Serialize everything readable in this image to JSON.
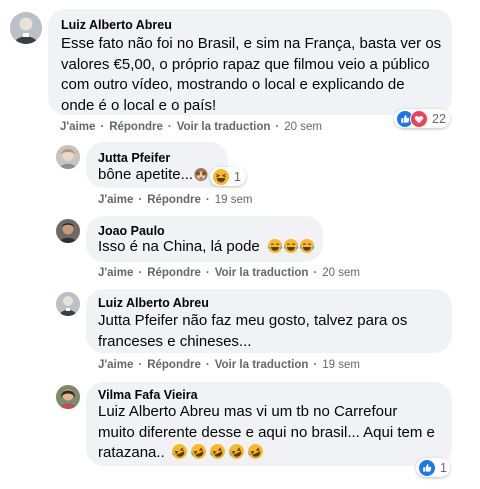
{
  "comments": [
    {
      "author": "Luiz Alberto Abreu",
      "text_lines": [
        "Esse fato não foi no Brasil, e sim na França, basta ver os",
        "valores €5,00, o próprio rapaz que filmou veio a público",
        "com outro vídeo, mostrando o local e explicando de",
        "onde é o local e o país!"
      ],
      "actions": {
        "like": "J'aime",
        "reply": "Répondre",
        "translate": "Voir la traduction",
        "time": "20 sem"
      },
      "reactions": {
        "icons": [
          "like-icon",
          "love-icon"
        ],
        "count": "22"
      }
    },
    {
      "author": "Jutta Pfeifer",
      "text": "bône apetite...",
      "text_emoji": "see-no-evil-monkey-icon",
      "actions": {
        "like": "J'aime",
        "reply": "Répondre",
        "time": "19 sem"
      },
      "reactions": {
        "icons": [
          "haha-icon"
        ],
        "count": "1"
      }
    },
    {
      "author": "Joao Paulo",
      "text": "Isso é na China, lá pode",
      "text_emoji": "tears-of-joy-icon",
      "text_emoji_count": 3,
      "actions": {
        "like": "J'aime",
        "reply": "Répondre",
        "translate": "Voir la traduction",
        "time": "20 sem"
      }
    },
    {
      "author": "Luiz Alberto Abreu",
      "text_lines": [
        "Jutta Pfeifer não faz meu gosto, talvez para os",
        "franceses e chineses..."
      ],
      "actions": {
        "like": "J'aime",
        "reply": "Répondre",
        "translate": "Voir la traduction",
        "time": "19 sem"
      }
    },
    {
      "author": "Vilma Fafa Vieira",
      "text_lines": [
        "Luiz Alberto Abreu mas vi um tb no Carrefour",
        "muito diferente desse e aqui no brasil... Aqui tem e",
        "ratazana.."
      ],
      "text_emoji": "rolling-on-floor-laughing-icon",
      "text_emoji_count": 5,
      "reactions": {
        "icons": [
          "like-icon"
        ],
        "count": "1"
      }
    }
  ],
  "colors": {
    "bubble": "#f0f2f5",
    "secondary_text": "#65676b",
    "like_blue": "#1877f2",
    "love_red": "#f33e58",
    "haha_yellow": "#f7b928"
  }
}
